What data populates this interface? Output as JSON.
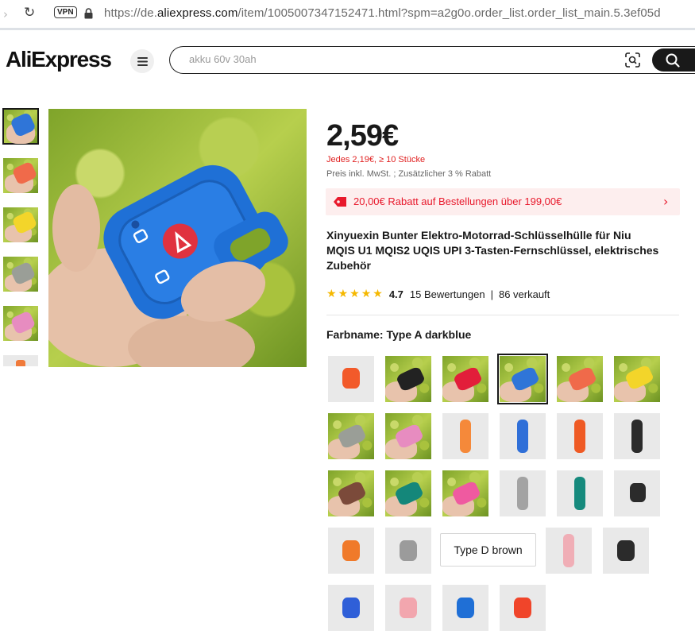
{
  "browser": {
    "vpn_label": "VPN",
    "url_prefix": "https://de.",
    "url_host": "aliexpress.com",
    "url_rest": "/item/1005007347152471.html?spm=a2g0o.order_list.order_list_main.5.3ef05d"
  },
  "header": {
    "logo": "AliExpress",
    "search_placeholder": "akku 60v 30ah"
  },
  "product": {
    "price": "2,59€",
    "bulk_price": "Jedes 2,19€, ≥ 10 Stücke",
    "vat_note": "Preis inkl. MwSt. ; Zusätzlicher 3 % Rabatt",
    "coupon": "20,00€ Rabatt auf Bestellungen über 199,00€",
    "title": "Xinyuexin Bunter Elektro-Motorrad-Schlüsselhülle für Niu MQIS U1 MQIS2 UQIS UPI 3-Tasten-Fernschlüssel, elektrisches Zubehör",
    "rating_score": "4.7",
    "reviews": "15 Bewertungen",
    "sold": "86 verkauft",
    "color_label": "Farbname: Type A darkblue",
    "tooltip": "Type D brown"
  },
  "colors": {
    "accent_red": "#e8192c",
    "star": "#f5b800",
    "coupon_bg": "#fdeeee"
  }
}
